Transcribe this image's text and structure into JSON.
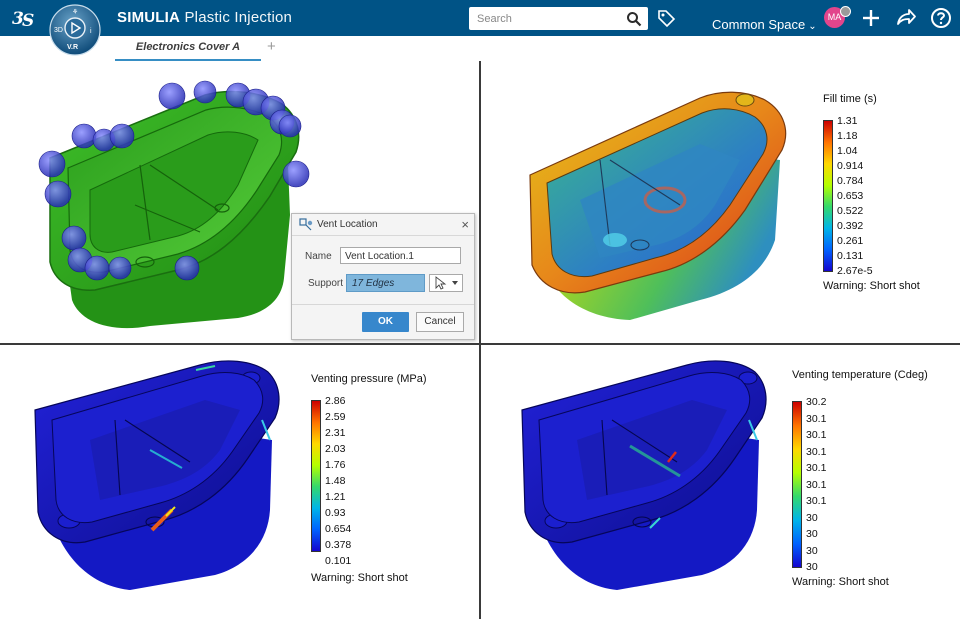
{
  "app": {
    "brand": "SIMULIA",
    "name": "Plastic Injection",
    "compass_left": "3D",
    "compass_bottom": "V.R",
    "compass_right": "i",
    "compass_top": "⚘"
  },
  "search": {
    "placeholder": "Search"
  },
  "header": {
    "space": "Common Space",
    "avatar_initials": "MA"
  },
  "tabs": [
    {
      "label": "Electronics Cover A"
    }
  ],
  "dialog": {
    "title": "Vent Location",
    "name_label": "Name",
    "name_value": "Vent Location.1",
    "support_label": "Support",
    "support_value": "17 Edges",
    "ok_label": "OK",
    "cancel_label": "Cancel"
  },
  "legends": {
    "fill_time": {
      "title": "Fill time (s)",
      "values": [
        "1.31",
        "1.18",
        "1.04",
        "0.914",
        "0.784",
        "0.653",
        "0.522",
        "0.392",
        "0.261",
        "0.131",
        "2.67e-5"
      ],
      "warning": "Warning: Short shot"
    },
    "venting_pressure": {
      "title": "Venting pressure (MPa)",
      "values": [
        "2.86",
        "2.59",
        "2.31",
        "2.03",
        "1.76",
        "1.48",
        "1.21",
        "0.93",
        "0.654",
        "0.378",
        "0.101"
      ],
      "warning": "Warning: Short shot"
    },
    "venting_temperature": {
      "title": "Venting temperature (Cdeg)",
      "values": [
        "30.2",
        "30.1",
        "30.1",
        "30.1",
        "30.1",
        "30.1",
        "30.1",
        "30",
        "30",
        "30",
        "30"
      ],
      "warning": "Warning: Short shot"
    }
  },
  "colors": {
    "topbar": "#005386",
    "tab_underline": "#368ec4",
    "ok_button": "#3787cc",
    "model_green": "#3fb427",
    "vent_sphere": "#3b3fc8"
  },
  "icons": {
    "logo": "ds-logo-icon",
    "search": "search-icon",
    "tag": "tag-icon",
    "add": "plus-icon",
    "share": "share-icon",
    "help": "help-icon"
  }
}
